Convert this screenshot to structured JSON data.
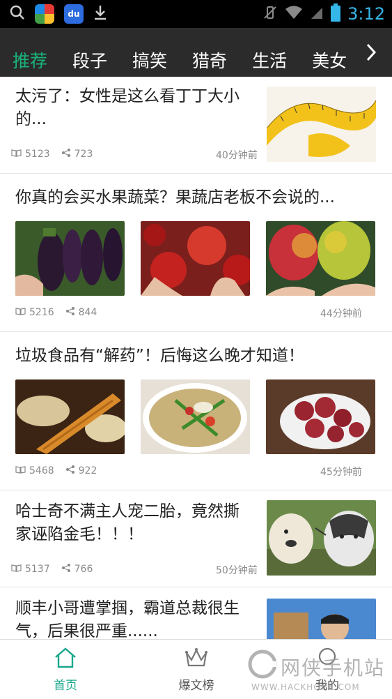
{
  "status_bar": {
    "time": "3:12",
    "baidu_icon_text": "du",
    "icons": [
      "search-icon",
      "app-store-icon",
      "baidu-icon",
      "download-icon",
      "vibrate-mute-icon",
      "wifi-icon",
      "signal-icon",
      "battery-icon"
    ]
  },
  "tabs": [
    "推荐",
    "段子",
    "搞笑",
    "猎奇",
    "生活",
    "美女"
  ],
  "active_tab": "推荐",
  "colors": {
    "accent": "#1ab37a",
    "tab_bar_bg": "#2b2b2b",
    "clock": "#35b6e8",
    "meta_text": "#8a8a8a"
  },
  "articles": [
    {
      "title": "太污了：女性是这么看丁丁大小的...",
      "reads": "5123",
      "shares": "723",
      "time": "40分钟前",
      "images": [
        "measuring-tape"
      ]
    },
    {
      "title": "你真的会买水果蔬菜？果蔬店老板不会说的...",
      "reads": "5216",
      "shares": "844",
      "time": "44分钟前",
      "images": [
        "eggplants",
        "tomatoes",
        "mangoes"
      ]
    },
    {
      "title": "垃圾食品有“解药”！后悔这么晚才知道！",
      "reads": "5468",
      "shares": "922",
      "time": "45分钟前",
      "images": [
        "fried-dough-soymilk",
        "soup-bowl",
        "sausage-plate"
      ]
    },
    {
      "title": "哈士奇不满主人宠二胎，竟然撕家诬陷金毛！！！",
      "reads": "5137",
      "shares": "766",
      "time": "50分钟前",
      "images": [
        "husky-and-golden"
      ]
    },
    {
      "title": "顺丰小哥遭掌掴，霸道总裁很生气，后果很严重......",
      "images": [
        "delivery-man"
      ]
    }
  ],
  "bottom_nav": [
    {
      "label": "首页",
      "icon": "home-icon",
      "active": true
    },
    {
      "label": "爆文榜",
      "icon": "crown-icon",
      "active": false
    },
    {
      "label": "我的",
      "icon": "user-icon",
      "active": false
    }
  ],
  "watermark": {
    "text": "网侠手机站",
    "url": "WWW.HACKHOME.COM"
  }
}
